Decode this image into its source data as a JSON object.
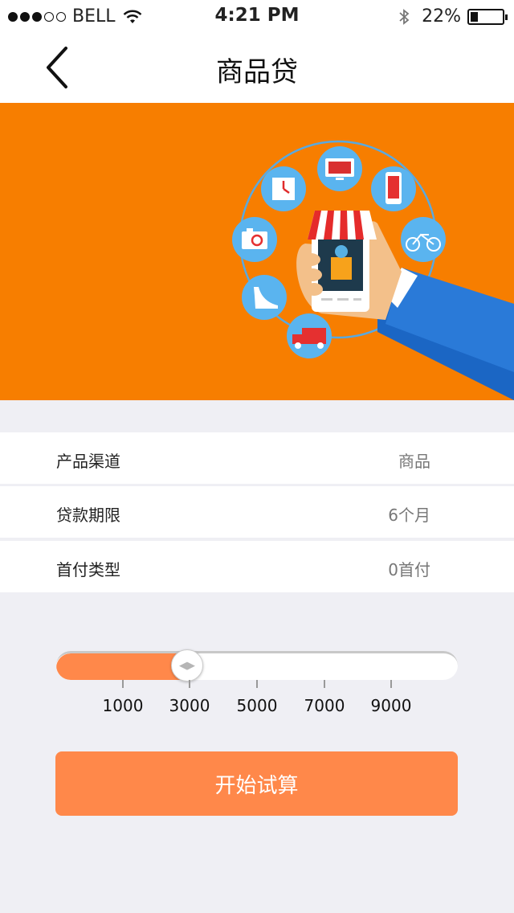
{
  "status": {
    "carrier": "BELL",
    "time": "4:21 PM",
    "battery": "22%",
    "signal_bars_filled": 3,
    "signal_bars_total": 5
  },
  "nav": {
    "title": "商品贷"
  },
  "details": [
    {
      "label": "产品渠道",
      "value": "商品"
    },
    {
      "label": "贷款期限",
      "value": "6个月"
    },
    {
      "label": "首付类型",
      "value": "0首付"
    }
  ],
  "slider": {
    "ticks": [
      "1000",
      "3000",
      "5000",
      "7000",
      "9000"
    ],
    "value": "3000"
  },
  "cta": {
    "label": "开始试算"
  },
  "colors": {
    "banner": "#f77e00",
    "accent": "#ff884a",
    "background": "#efeff4"
  }
}
